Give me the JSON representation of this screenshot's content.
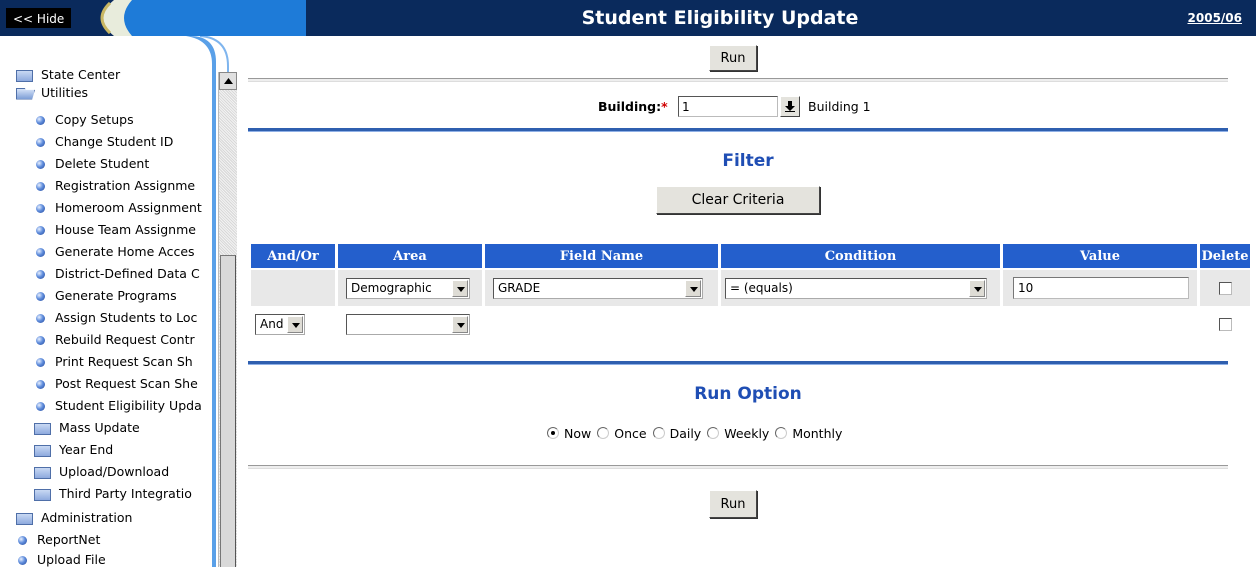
{
  "header": {
    "hide_label": "<< Hide",
    "title": "Student Eligibility Update",
    "year": "2005/06"
  },
  "sidebar": {
    "items": [
      {
        "label": "State Center",
        "icon": "folder-icon"
      },
      {
        "label": "Utilities",
        "icon": "folder-open-icon"
      },
      {
        "label": "Copy Setups",
        "icon": "bullet-icon"
      },
      {
        "label": "Change Student ID",
        "icon": "bullet-icon"
      },
      {
        "label": "Delete Student",
        "icon": "bullet-icon"
      },
      {
        "label": "Registration Assignme",
        "icon": "bullet-icon"
      },
      {
        "label": "Homeroom Assignment",
        "icon": "bullet-icon"
      },
      {
        "label": "House Team Assignme",
        "icon": "bullet-icon"
      },
      {
        "label": "Generate Home Acces",
        "icon": "bullet-icon"
      },
      {
        "label": "District-Defined Data C",
        "icon": "bullet-icon"
      },
      {
        "label": "Generate Programs",
        "icon": "bullet-icon"
      },
      {
        "label": "Assign Students to Loc",
        "icon": "bullet-icon"
      },
      {
        "label": "Rebuild Request Contr",
        "icon": "bullet-icon"
      },
      {
        "label": "Print Request Scan Sh",
        "icon": "bullet-icon"
      },
      {
        "label": "Post Request Scan She",
        "icon": "bullet-icon"
      },
      {
        "label": "Student Eligibility Upda",
        "icon": "bullet-icon"
      },
      {
        "label": "Mass Update",
        "icon": "folder-icon"
      },
      {
        "label": "Year End",
        "icon": "folder-icon"
      },
      {
        "label": "Upload/Download",
        "icon": "folder-icon"
      },
      {
        "label": "Third Party Integratio",
        "icon": "folder-icon"
      },
      {
        "label": "Administration",
        "icon": "folder-icon"
      },
      {
        "label": "ReportNet",
        "icon": "bullet-icon"
      },
      {
        "label": "Upload File",
        "icon": "bullet-icon"
      }
    ]
  },
  "main": {
    "run_label": "Run",
    "building_label": "Building:",
    "building_required": "*",
    "building_value": "1",
    "building_name": "Building 1",
    "filter_title": "Filter",
    "clear_label": "Clear Criteria",
    "columns": [
      "And/Or",
      "Area",
      "Field Name",
      "Condition",
      "Value",
      "Delete"
    ],
    "row1": {
      "area": "Demographic",
      "field": "GRADE",
      "condition": "= (equals)",
      "value": "10"
    },
    "row2": {
      "andor": "And",
      "area": ""
    },
    "run_option_title": "Run Option",
    "run_options": [
      "Now",
      "Once",
      "Daily",
      "Weekly",
      "Monthly"
    ],
    "run_option_selected": "Now"
  },
  "colors": {
    "header_bg": "#0a2a5c",
    "table_header": "#245fcc",
    "section_title": "#1f4eb4",
    "rule_blue": "#2f5faf"
  }
}
